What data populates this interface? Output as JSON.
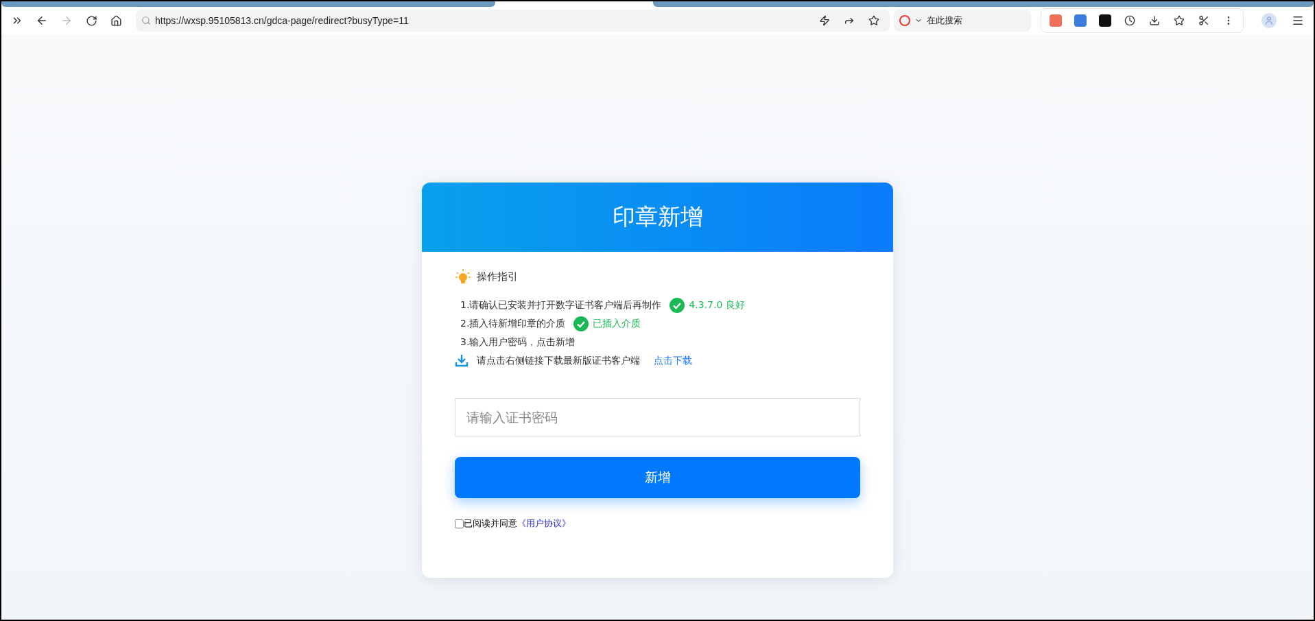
{
  "browser": {
    "url": "https://wxsp.95105813.cn/gdca-page/redirect?busyType=11",
    "search_placeholder": "在此搜索"
  },
  "card": {
    "title": "印章新增",
    "guide_title": "操作指引",
    "steps": [
      {
        "text": "1.请确认已安装并打开数字证书客户端后再制作",
        "status": "4.3.7.0 良好",
        "ok": true
      },
      {
        "text": "2.插入待新增印章的介质",
        "status": "已插入介质",
        "ok": true
      },
      {
        "text": "3.输入用户密码，点击新增"
      }
    ],
    "download": {
      "text": "请点击右侧链接下载最新版证书客户端",
      "link": "点击下载"
    },
    "password": {
      "placeholder": "请输入证书密码"
    },
    "submit": "新增",
    "agreement": {
      "checked": false,
      "text": "已阅读并同意",
      "link": "《用户协议》"
    }
  }
}
